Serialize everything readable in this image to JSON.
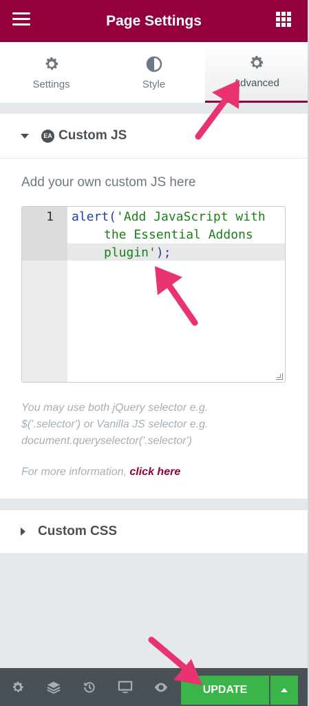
{
  "header": {
    "title": "Page Settings"
  },
  "tabs": [
    {
      "label": "Settings"
    },
    {
      "label": "Style"
    },
    {
      "label": "Advanced"
    }
  ],
  "custom_js": {
    "heading": "Custom JS",
    "badge": "EA",
    "field_label": "Add your own custom JS here",
    "line_number": "1",
    "code": {
      "fn": "alert(",
      "str1": "'Add JavaScript with",
      "str2": "the Essential Addons",
      "str3": "plugin'",
      "end": ");"
    },
    "help_text": "You may use both jQuery selector e.g. $('.selector') or Vanilla JS selector e.g. document.queryselector('.selector')",
    "more_info_prefix": "For more information, ",
    "more_info_link": "click here"
  },
  "custom_css": {
    "heading": "Custom CSS"
  },
  "footer": {
    "update_label": "UPDATE"
  },
  "colors": {
    "brand": "#93003c",
    "update": "#39b54a",
    "annotation_arrow": "#e8336e"
  }
}
